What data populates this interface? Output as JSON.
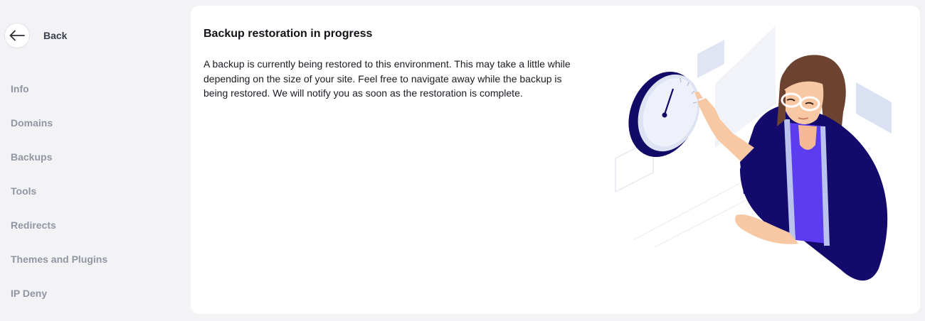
{
  "sidebar": {
    "back_label": "Back",
    "items": [
      {
        "label": "Info"
      },
      {
        "label": "Domains"
      },
      {
        "label": "Backups"
      },
      {
        "label": "Tools"
      },
      {
        "label": "Redirects"
      },
      {
        "label": "Themes and Plugins"
      },
      {
        "label": "IP Deny"
      }
    ]
  },
  "main": {
    "title": "Backup restoration in progress",
    "description": "A backup is currently being restored to this environment. This may take a little while depending on the size of your site. Feel free to navigate away while the backup is being restored. We will notify you as soon as the restoration is complete.",
    "illustration_icon": "person-with-clock-illustration"
  },
  "colors": {
    "page_bg": "#f3f3f5",
    "card_bg": "#ffffff",
    "nav_text": "#9196a3",
    "accent_navy": "#140a6b",
    "accent_purple": "#5b3cf0"
  }
}
